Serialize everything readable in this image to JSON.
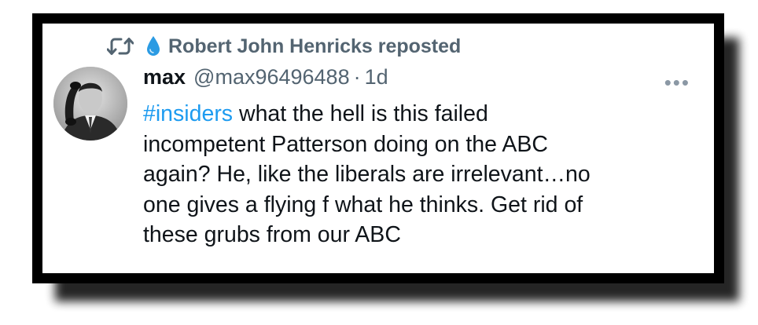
{
  "repost": {
    "label": "Robert John Henricks reposted",
    "icon": "repost-icon",
    "emoji_icon": "droplet-icon",
    "drop_color": "#2b9be3"
  },
  "tweet": {
    "author_name": "max",
    "handle": "@max96496488",
    "separator": "·",
    "age": "1d",
    "hashtag": "#insiders",
    "lines": [
      " what the hell is this failed",
      "incompetent Patterson doing on the ABC",
      "again?  He, like the liberals are irrelevant…no",
      "one gives a flying f what he thinks.  Get rid of",
      "these grubs from our ABC"
    ],
    "more_label": "•••",
    "hashtag_color": "#1d9bf0",
    "text_color": "#0f1419",
    "muted_color": "#536471"
  }
}
